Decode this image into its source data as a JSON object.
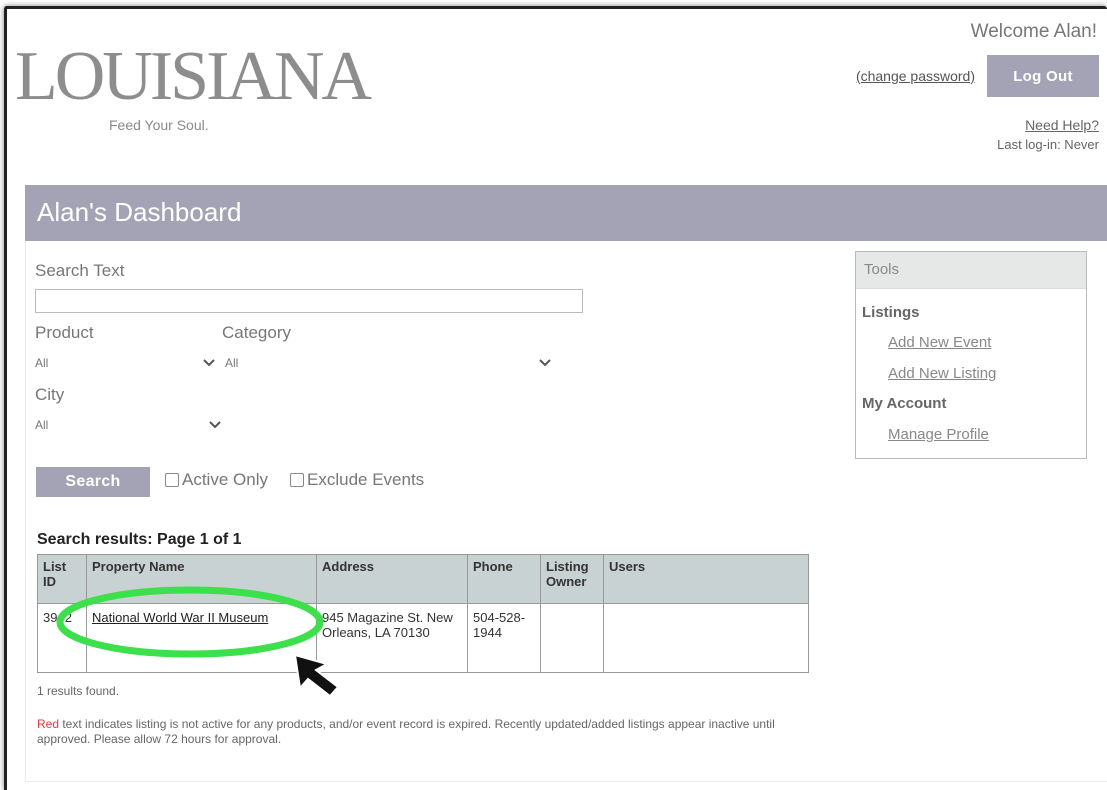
{
  "header": {
    "logo_word": "LOUISIANA",
    "logo_tagline": "Feed Your Soul.",
    "welcome": "Welcome Alan!",
    "change_password": "(change password)",
    "logout": "Log Out",
    "need_help": "Need Help?",
    "last_login": "Last log-in: Never"
  },
  "dashboard": {
    "title": "Alan's Dashboard"
  },
  "filters": {
    "search_text_label": "Search Text",
    "search_text_value": "",
    "product_label": "Product",
    "product_value": "All",
    "category_label": "Category",
    "category_value": "All",
    "city_label": "City",
    "city_value": "All",
    "search_button": "Search",
    "active_only": "Active Only",
    "exclude_events": "Exclude Events"
  },
  "tools": {
    "title": "Tools",
    "listings_heading": "Listings",
    "add_new_event": "Add New Event",
    "add_new_listing": "Add New Listing",
    "my_account_heading": "My Account",
    "manage_profile": "Manage Profile"
  },
  "results": {
    "title": "Search results: Page 1 of 1",
    "columns": [
      "List ID",
      "Property Name",
      "Address",
      "Phone",
      "Listing Owner",
      "Users"
    ],
    "rows": [
      {
        "list_id": "3942",
        "property_name": "National World War II Museum",
        "address": "945 Magazine St. New Orleans, LA 70130",
        "phone": "504-528-1944",
        "listing_owner": "",
        "users": ""
      }
    ],
    "found": "1 results found.",
    "note_red": "Red",
    "note_rest": " text indicates listing is not active for any products, and/or event record is expired. Recently updated/added listings appear inactive until approved. Please allow 72 hours for approval."
  },
  "colors": {
    "accent": "#a4a3b6",
    "table_header": "#c9d2d2",
    "highlight_circle": "#3be04a",
    "note_red": "#e53a3a"
  }
}
